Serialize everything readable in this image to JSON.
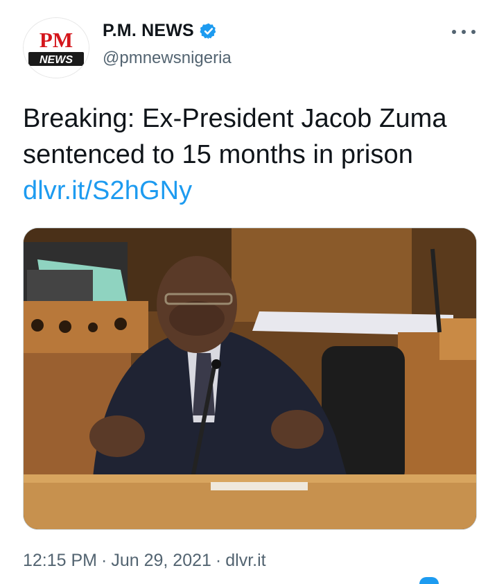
{
  "account": {
    "display_name": "P.M. NEWS",
    "handle": "@pmnewsnigeria",
    "verified": true,
    "avatar": {
      "logo_top": "PM",
      "logo_bottom": "NEWS"
    }
  },
  "more_icon": "more-horizontal-icon",
  "tweet": {
    "text": "Breaking: Ex-President Jacob Zuma sentenced to 15 months in prison ",
    "link_text": "dlvr.it/S2hGNy"
  },
  "media": {
    "icon": "photo"
  },
  "meta": {
    "time": "12:15 PM",
    "separator": "·",
    "date": "Jun 29, 2021",
    "source": "dlvr.it"
  },
  "colors": {
    "link": "#1d9bf0",
    "secondary_text": "#536471",
    "brand_red": "#d4161c",
    "verified": "#1d9bf0"
  }
}
